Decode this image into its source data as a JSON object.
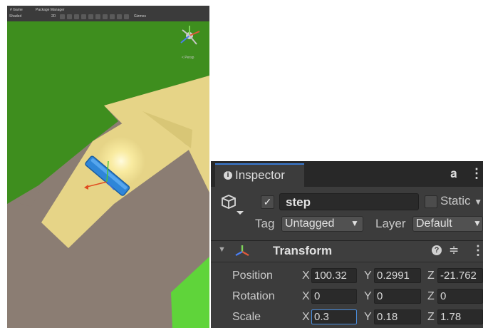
{
  "scene": {
    "toolbar": {
      "tab1": "# Game",
      "tab2": "Package Manager",
      "shading": "Shaded",
      "mode": "2D",
      "gizmos": "Gizmos"
    },
    "gizmo_label": "< Persp",
    "colors": {
      "grass": "#3e8e1e",
      "ground": "#8b7d73",
      "ramp": "#e6d487",
      "plank": "#2f86d8"
    }
  },
  "inspector": {
    "tab_label": "Inspector",
    "lock_icon": "lock-icon",
    "menu_icon": "kebab-menu-icon",
    "object": {
      "active": true,
      "active_mark": "✓",
      "name": "step",
      "static_label": "Static",
      "tag_label": "Tag",
      "tag_value": "Untagged",
      "layer_label": "Layer",
      "layer_value": "Default",
      "dropdown_arrow": "▼"
    },
    "transform": {
      "title": "Transform",
      "help_icon": "?",
      "preset_icon": "≑",
      "menu_icon": "⋮",
      "rows": {
        "position": {
          "label": "Position",
          "x": "100.32",
          "y": "0.2991",
          "z": "-21.762"
        },
        "rotation": {
          "label": "Rotation",
          "x": "0",
          "y": "0",
          "z": "0"
        },
        "scale": {
          "label": "Scale",
          "x": "0.3",
          "y": "0.18",
          "z": "1.78"
        }
      },
      "axes": {
        "x": "X",
        "y": "Y",
        "z": "Z"
      }
    }
  }
}
